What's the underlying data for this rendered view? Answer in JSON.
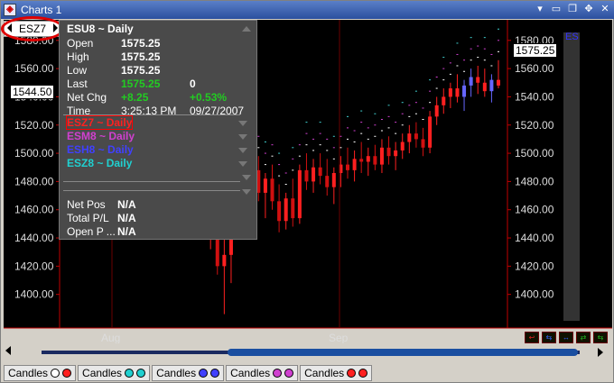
{
  "window": {
    "title": "Charts 1"
  },
  "symbol_tab": {
    "label": "ESZ7"
  },
  "info": {
    "title": "ESU8 ~ Daily",
    "rows": [
      {
        "label": "Open",
        "value": "1575.25",
        "value2": ""
      },
      {
        "label": "High",
        "value": "1575.25",
        "value2": ""
      },
      {
        "label": "Low",
        "value": "1575.25",
        "value2": ""
      },
      {
        "label": "Last",
        "value": "1575.25",
        "value2": "0"
      },
      {
        "label": "Net Chg",
        "value": "+8.25",
        "value2": "+0.53%"
      },
      {
        "label": "Time",
        "value": "3:25:13 PM",
        "value2": "09/27/2007"
      }
    ],
    "symbols": [
      {
        "label": "ESZ7 ~ Daily",
        "color": "#ff2020"
      },
      {
        "label": "ESM8 ~ Daily",
        "color": "#d040d0"
      },
      {
        "label": "ESH8 ~ Daily",
        "color": "#4040ff"
      },
      {
        "label": "ESZ8 ~ Daily",
        "color": "#20d0d0"
      }
    ],
    "positions": [
      {
        "label": "Net Pos",
        "value": "N/A"
      },
      {
        "label": "Total P/L",
        "value": "N/A"
      },
      {
        "label": "Open P ...",
        "value": "N/A"
      }
    ]
  },
  "price_left": "1544.50",
  "price_right": "1575.25",
  "right_marker": "ES",
  "x_labels": [
    "Aug",
    "Sep"
  ],
  "tabs": [
    {
      "label": "Candles",
      "colors": [
        "#ffffff",
        "#ff2020"
      ]
    },
    {
      "label": "Candles",
      "colors": [
        "#20d0d0",
        "#20d0d0"
      ]
    },
    {
      "label": "Candles",
      "colors": [
        "#4040ff",
        "#4040ff"
      ]
    },
    {
      "label": "Candles",
      "colors": [
        "#d040d0",
        "#d040d0"
      ]
    },
    {
      "label": "Candles",
      "colors": [
        "#ff2020",
        "#ff2020"
      ]
    }
  ],
  "chart_data": {
    "type": "candlestick",
    "yticks": [
      1580,
      1560,
      1540,
      1520,
      1500,
      1480,
      1460,
      1440,
      1420,
      1400
    ],
    "ylim": [
      1380,
      1592
    ],
    "candles": [
      {
        "o": 1488,
        "h": 1496,
        "l": 1470,
        "c": 1478
      },
      {
        "o": 1478,
        "h": 1488,
        "l": 1448,
        "c": 1452
      },
      {
        "o": 1452,
        "h": 1470,
        "l": 1432,
        "c": 1462
      },
      {
        "o": 1462,
        "h": 1466,
        "l": 1414,
        "c": 1420
      },
      {
        "o": 1420,
        "h": 1440,
        "l": 1386,
        "c": 1428
      },
      {
        "o": 1428,
        "h": 1452,
        "l": 1408,
        "c": 1446
      },
      {
        "o": 1446,
        "h": 1474,
        "l": 1440,
        "c": 1468
      },
      {
        "o": 1468,
        "h": 1488,
        "l": 1452,
        "c": 1458
      },
      {
        "o": 1458,
        "h": 1494,
        "l": 1452,
        "c": 1488
      },
      {
        "o": 1488,
        "h": 1498,
        "l": 1466,
        "c": 1472
      },
      {
        "o": 1472,
        "h": 1486,
        "l": 1454,
        "c": 1482
      },
      {
        "o": 1482,
        "h": 1492,
        "l": 1460,
        "c": 1466
      },
      {
        "o": 1466,
        "h": 1478,
        "l": 1444,
        "c": 1452
      },
      {
        "o": 1452,
        "h": 1472,
        "l": 1446,
        "c": 1468
      },
      {
        "o": 1468,
        "h": 1482,
        "l": 1448,
        "c": 1454
      },
      {
        "o": 1454,
        "h": 1492,
        "l": 1450,
        "c": 1488
      },
      {
        "o": 1488,
        "h": 1500,
        "l": 1474,
        "c": 1480
      },
      {
        "o": 1480,
        "h": 1496,
        "l": 1472,
        "c": 1490
      },
      {
        "o": 1490,
        "h": 1500,
        "l": 1478,
        "c": 1484
      },
      {
        "o": 1484,
        "h": 1496,
        "l": 1470,
        "c": 1476
      },
      {
        "o": 1476,
        "h": 1490,
        "l": 1464,
        "c": 1486
      },
      {
        "o": 1486,
        "h": 1498,
        "l": 1476,
        "c": 1492
      },
      {
        "o": 1492,
        "h": 1504,
        "l": 1482,
        "c": 1488
      },
      {
        "o": 1488,
        "h": 1502,
        "l": 1480,
        "c": 1496
      },
      {
        "o": 1496,
        "h": 1508,
        "l": 1486,
        "c": 1494
      },
      {
        "o": 1494,
        "h": 1504,
        "l": 1484,
        "c": 1498
      },
      {
        "o": 1498,
        "h": 1506,
        "l": 1488,
        "c": 1492
      },
      {
        "o": 1492,
        "h": 1510,
        "l": 1486,
        "c": 1504
      },
      {
        "o": 1504,
        "h": 1512,
        "l": 1492,
        "c": 1498
      },
      {
        "o": 1498,
        "h": 1508,
        "l": 1488,
        "c": 1502
      },
      {
        "o": 1502,
        "h": 1514,
        "l": 1496,
        "c": 1508
      },
      {
        "o": 1508,
        "h": 1520,
        "l": 1500,
        "c": 1514
      },
      {
        "o": 1514,
        "h": 1522,
        "l": 1504,
        "c": 1510
      },
      {
        "o": 1510,
        "h": 1518,
        "l": 1498,
        "c": 1504
      },
      {
        "o": 1504,
        "h": 1530,
        "l": 1500,
        "c": 1526
      },
      {
        "o": 1526,
        "h": 1540,
        "l": 1520,
        "c": 1534
      },
      {
        "o": 1534,
        "h": 1546,
        "l": 1528,
        "c": 1540
      },
      {
        "o": 1540,
        "h": 1550,
        "l": 1532,
        "c": 1546
      },
      {
        "o": 1546,
        "h": 1556,
        "l": 1536,
        "c": 1540
      },
      {
        "o": 1540,
        "h": 1552,
        "l": 1530,
        "c": 1548
      },
      {
        "o": 1548,
        "h": 1560,
        "l": 1540,
        "c": 1554
      },
      {
        "o": 1554,
        "h": 1562,
        "l": 1542,
        "c": 1550
      },
      {
        "o": 1550,
        "h": 1560,
        "l": 1540,
        "c": 1544
      },
      {
        "o": 1544,
        "h": 1556,
        "l": 1536,
        "c": 1552
      },
      {
        "o": 1552,
        "h": 1566,
        "l": 1546,
        "c": 1548
      }
    ]
  }
}
